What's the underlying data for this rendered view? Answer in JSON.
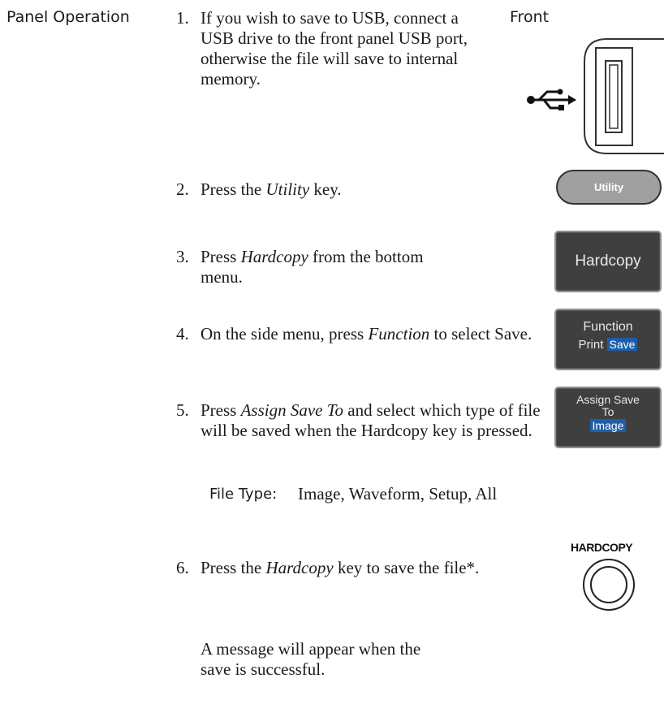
{
  "section_label": "Panel Operation",
  "front_label": "Front",
  "steps": [
    {
      "num": "1.",
      "pre": "If you wish to save to USB, connect a USB drive to the front panel USB port, otherwise the file will save to internal memory.",
      "em": "",
      "post": ""
    },
    {
      "num": "2.",
      "pre": "Press the ",
      "em": "Utility",
      "post": " key."
    },
    {
      "num": "3.",
      "pre": "Press ",
      "em": "Hardcopy",
      "post": " from the bottom menu."
    },
    {
      "num": "4.",
      "pre": "On the side menu, press ",
      "em": "Function",
      "post": " to select Save."
    },
    {
      "num": "5.",
      "pre": "Press ",
      "em": "Assign Save To",
      "post": " and select which type of file will be saved when the Hardcopy key is pressed."
    },
    {
      "num": "6.",
      "pre": "Press the ",
      "em": "Hardcopy",
      "post": " key to save the file*."
    }
  ],
  "file_type": {
    "label": "File Type:",
    "value": "Image, Waveform, Setup, All"
  },
  "message_text": "A message will appear when the save is successful.",
  "buttons": {
    "utility": "Utility",
    "hardcopy_menu": "Hardcopy",
    "function_title": "Function",
    "function_print": "Print",
    "function_save": "Save",
    "assign_line1": "Assign Save",
    "assign_line2": "To",
    "assign_value": "Image",
    "hardcopy_key": "HARDCOPY"
  },
  "colors": {
    "button_dark": "#3f3f3f",
    "highlight": "#1e5ea8",
    "utility_gray": "#9a9a9a"
  },
  "icons": [
    "usb-icon",
    "usb-port-icon",
    "hardcopy-round-key-icon"
  ]
}
